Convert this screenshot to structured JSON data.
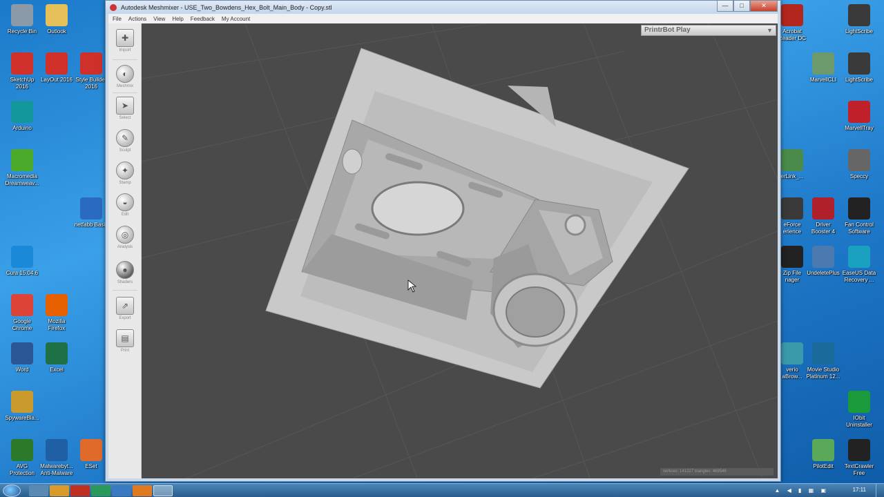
{
  "desktop_left": [
    {
      "label": "Recycle Bin",
      "icon": "recycle-bin-icon",
      "color": "#8a9aa8"
    },
    {
      "label": "Outlook",
      "icon": "folder-icon",
      "color": "#e6c15a"
    },
    {
      "label": "SketchUp\n2016",
      "icon": "sketchup-icon",
      "color": "#d0302a"
    },
    {
      "label": "LayOut 2016",
      "icon": "layout-icon",
      "color": "#d0302a"
    },
    {
      "label": "Style Builder\n2016",
      "icon": "style-builder-icon",
      "color": "#d0302a"
    },
    {
      "label": "Arduino",
      "icon": "arduino-icon",
      "color": "#14979c"
    },
    {
      "label": "Macromedia\nDreamweav...",
      "icon": "dreamweaver-icon",
      "color": "#4caa2a"
    },
    {
      "label": "netfabb Basic",
      "icon": "netfabb-icon",
      "color": "#2a6ac0"
    },
    {
      "label": "Cura 15.04.6",
      "icon": "cura-icon",
      "color": "#1a8ad8"
    },
    {
      "label": "Google\nChrome",
      "icon": "chrome-icon",
      "color": "#db4437"
    },
    {
      "label": "Mozilla\nFirefox",
      "icon": "firefox-icon",
      "color": "#e66000"
    },
    {
      "label": "Word",
      "icon": "word-icon",
      "color": "#2b5797"
    },
    {
      "label": "Excel",
      "icon": "excel-icon",
      "color": "#1e7145"
    },
    {
      "label": "SpywareBla...",
      "icon": "spywareblaster-icon",
      "color": "#c99a2e"
    },
    {
      "label": "AVG\nProtection",
      "icon": "avg-icon",
      "color": "#2a7a2a"
    },
    {
      "label": "Malwarebyt...\nAnti-Malware",
      "icon": "malwarebytes-icon",
      "color": "#1f5fa3"
    },
    {
      "label": "ESet",
      "icon": "eset-icon",
      "color": "#e06a2a"
    }
  ],
  "desktop_right": [
    {
      "label": "Acrobat\nReader DC",
      "icon": "acrobat-icon",
      "color": "#b3261e"
    },
    {
      "label": "LightScribe",
      "icon": "lightscribe-icon",
      "color": "#3a3a3a"
    },
    {
      "label": "MarvellCLI",
      "icon": "marvellcli-icon",
      "color": "#6c9a6c"
    },
    {
      "label": "LightScribe",
      "icon": "lightscribe-icon",
      "color": "#3a3a3a"
    },
    {
      "label": "MarvellTray",
      "icon": "marvelltray-icon",
      "color": "#c0202a"
    },
    {
      "label": "erLink_...",
      "icon": "powerlink-icon",
      "color": "#4a8a4a"
    },
    {
      "label": "Speccy",
      "icon": "speccy-icon",
      "color": "#666666"
    },
    {
      "label": "eForce\nerience",
      "icon": "geforce-icon",
      "color": "#3a3a3a"
    },
    {
      "label": "Driver\nBooster 4",
      "icon": "driver-booster-icon",
      "color": "#b0202a"
    },
    {
      "label": "Fan Control\nSoftware",
      "icon": "fan-control-icon",
      "color": "#222222"
    },
    {
      "label": "Zip File\nnager",
      "icon": "7zip-icon",
      "color": "#222222"
    },
    {
      "label": "UndeletePlus",
      "icon": "undeleteplus-icon",
      "color": "#4a7ab0"
    },
    {
      "label": "EaseUS Data\nRecovery ...",
      "icon": "easeus-icon",
      "color": "#1aa0c0"
    },
    {
      "label": "verio\naBrow...",
      "icon": "pxverio-icon",
      "color": "#3a9aaa"
    },
    {
      "label": "Movie Studio\nPlatinum 12...",
      "icon": "movie-studio-icon",
      "color": "#1a6a9a"
    },
    {
      "label": "IObit\nUninstaller",
      "icon": "iobit-icon",
      "color": "#1a9a3a"
    },
    {
      "label": "PilotEdit",
      "icon": "pilotedit-icon",
      "color": "#5aa85a"
    },
    {
      "label": "TextCrawler\nFree",
      "icon": "textcrawler-icon",
      "color": "#222222"
    }
  ],
  "window": {
    "title": "Autodesk Meshmixer - USE_Two_Bowdens_Hex_Bolt_Main_Body - Copy.stl",
    "minimize": "—",
    "maximize": "□",
    "close": "✕"
  },
  "menu": [
    "File",
    "Actions",
    "View",
    "Help",
    "Feedback",
    "My Account"
  ],
  "tools": [
    {
      "label": "Import",
      "icon": "import-icon",
      "glyph": "✚"
    },
    {
      "label": "Meshmix",
      "icon": "meshmix-icon",
      "glyph": "◐"
    },
    {
      "label": "Select",
      "icon": "select-icon",
      "glyph": "➤"
    },
    {
      "label": "Sculpt",
      "icon": "sculpt-icon",
      "glyph": "✎"
    },
    {
      "label": "Stamp",
      "icon": "stamp-icon",
      "glyph": "✦"
    },
    {
      "label": "Edit",
      "icon": "edit-icon",
      "glyph": "◒"
    },
    {
      "label": "Analysis",
      "icon": "analysis-icon",
      "glyph": "◎"
    },
    {
      "label": "Shaders",
      "icon": "shaders-icon",
      "glyph": "●"
    },
    {
      "label": "Export",
      "icon": "export-icon",
      "glyph": "⇗"
    },
    {
      "label": "Print",
      "icon": "print-icon",
      "glyph": "▤"
    }
  ],
  "printer": {
    "selected": "PrintrBot Play",
    "arrow": "▼"
  },
  "stats": "vertices: 141227 triangles: 469546",
  "taskbar": {
    "clock": "17:11",
    "tray": "▲ ◀ ▮ ▦ ▣"
  },
  "colors": {
    "viewport": "#4a4a4a",
    "model": "#bdbdbd",
    "grid": "#5a5a5a"
  }
}
